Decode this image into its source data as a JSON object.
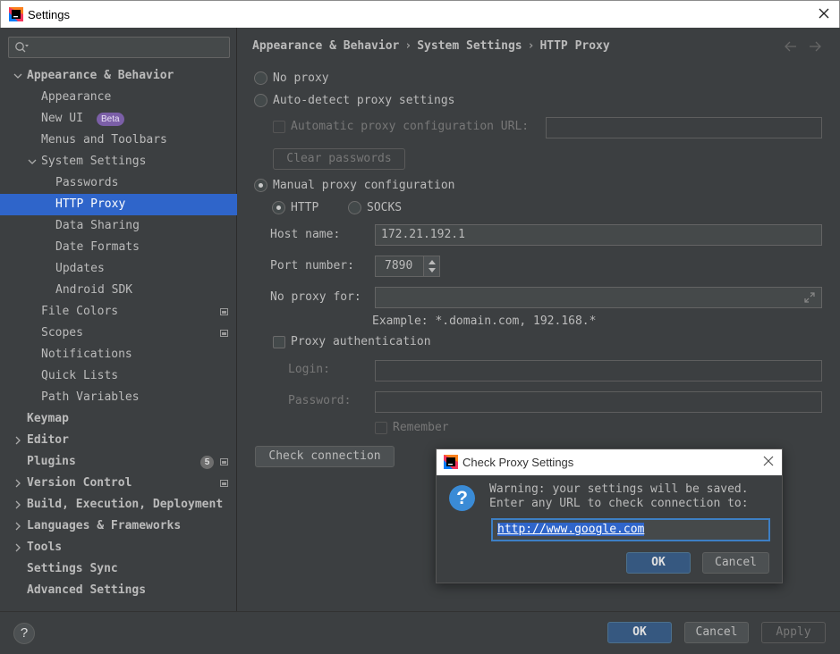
{
  "window": {
    "title": "Settings"
  },
  "sidebar": {
    "search_placeholder": "",
    "items": [
      {
        "label": "Appearance & Behavior",
        "level": 0,
        "bold": true,
        "expanded": true
      },
      {
        "label": "Appearance",
        "level": 1
      },
      {
        "label": "New UI",
        "level": 1,
        "badge": "Beta"
      },
      {
        "label": "Menus and Toolbars",
        "level": 1
      },
      {
        "label": "System Settings",
        "level": 1,
        "expanded": true
      },
      {
        "label": "Passwords",
        "level": 2
      },
      {
        "label": "HTTP Proxy",
        "level": 2,
        "selected": true
      },
      {
        "label": "Data Sharing",
        "level": 2
      },
      {
        "label": "Date Formats",
        "level": 2
      },
      {
        "label": "Updates",
        "level": 2
      },
      {
        "label": "Android SDK",
        "level": 2
      },
      {
        "label": "File Colors",
        "level": 1,
        "project_icon": true
      },
      {
        "label": "Scopes",
        "level": 1,
        "project_icon": true
      },
      {
        "label": "Notifications",
        "level": 1
      },
      {
        "label": "Quick Lists",
        "level": 1
      },
      {
        "label": "Path Variables",
        "level": 1
      },
      {
        "label": "Keymap",
        "level": 0,
        "bold": true
      },
      {
        "label": "Editor",
        "level": 0,
        "bold": true,
        "collapsed": true
      },
      {
        "label": "Plugins",
        "level": 0,
        "bold": true,
        "count": "5",
        "project_icon": true
      },
      {
        "label": "Version Control",
        "level": 0,
        "bold": true,
        "collapsed": true,
        "project_icon": true
      },
      {
        "label": "Build, Execution, Deployment",
        "level": 0,
        "bold": true,
        "collapsed": true
      },
      {
        "label": "Languages & Frameworks",
        "level": 0,
        "bold": true,
        "collapsed": true
      },
      {
        "label": "Tools",
        "level": 0,
        "bold": true,
        "collapsed": true
      },
      {
        "label": "Settings Sync",
        "level": 0,
        "bold": true
      },
      {
        "label": "Advanced Settings",
        "level": 0,
        "bold": true
      }
    ]
  },
  "breadcrumb": [
    "Appearance & Behavior",
    "System Settings",
    "HTTP Proxy"
  ],
  "proxy": {
    "no_proxy": "No proxy",
    "auto_detect": "Auto-detect proxy settings",
    "auto_config_url": "Automatic proxy configuration URL:",
    "clear_passwords": "Clear passwords",
    "manual": "Manual proxy configuration",
    "http": "HTTP",
    "socks": "SOCKS",
    "host_label": "Host name:",
    "host_value": "172.21.192.1",
    "port_label": "Port number:",
    "port_value": "7890",
    "no_proxy_for_label": "No proxy for:",
    "no_proxy_for_value": "",
    "example": "Example: *.domain.com, 192.168.*",
    "proxy_auth": "Proxy authentication",
    "login_label": "Login:",
    "password_label": "Password:",
    "remember": "Remember",
    "check_connection": "Check connection"
  },
  "dialog": {
    "title": "Check Proxy Settings",
    "message_line1": "Warning: your settings will be saved.",
    "message_line2": "Enter any URL to check connection to:",
    "url": "http://www.google.com",
    "ok": "OK",
    "cancel": "Cancel"
  },
  "footer": {
    "help": "?",
    "ok": "OK",
    "cancel": "Cancel",
    "apply": "Apply"
  }
}
